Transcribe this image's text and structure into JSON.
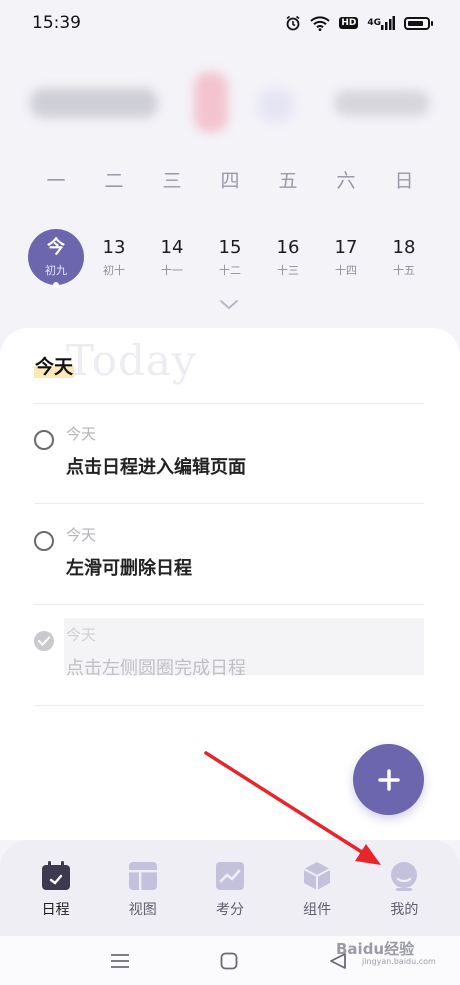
{
  "status_bar": {
    "time": "15:39",
    "network_badge": "HD",
    "signal_label": "4G"
  },
  "calendar": {
    "weekdays": [
      "一",
      "二",
      "三",
      "四",
      "五",
      "六",
      "日"
    ],
    "days": [
      {
        "num": "今",
        "lunar": "初九"
      },
      {
        "num": "13",
        "lunar": "初十"
      },
      {
        "num": "14",
        "lunar": "十一"
      },
      {
        "num": "15",
        "lunar": "十二"
      },
      {
        "num": "16",
        "lunar": "十三"
      },
      {
        "num": "17",
        "lunar": "十四"
      },
      {
        "num": "18",
        "lunar": "十五"
      }
    ],
    "selected_index": 0
  },
  "section": {
    "title": "今天",
    "ghost": "Today"
  },
  "tasks": [
    {
      "date": "今天",
      "title": "点击日程进入编辑页面",
      "done": false
    },
    {
      "date": "今天",
      "title": "左滑可删除日程",
      "done": false
    },
    {
      "date": "今天",
      "title": "点击左侧圆圈完成日程",
      "done": true
    }
  ],
  "tabs": [
    {
      "label": "日程",
      "icon": "calendar-icon",
      "active": true
    },
    {
      "label": "视图",
      "icon": "layout-icon",
      "active": false
    },
    {
      "label": "考分",
      "icon": "chart-icon",
      "active": false
    },
    {
      "label": "组件",
      "icon": "cube-icon",
      "active": false
    },
    {
      "label": "我的",
      "icon": "profile-icon",
      "active": false
    }
  ],
  "watermark": {
    "main": "Baidu经验",
    "sub": "jingyan.baidu.com"
  },
  "colors": {
    "accent": "#6b66ad",
    "annotation": "#e8252a"
  }
}
